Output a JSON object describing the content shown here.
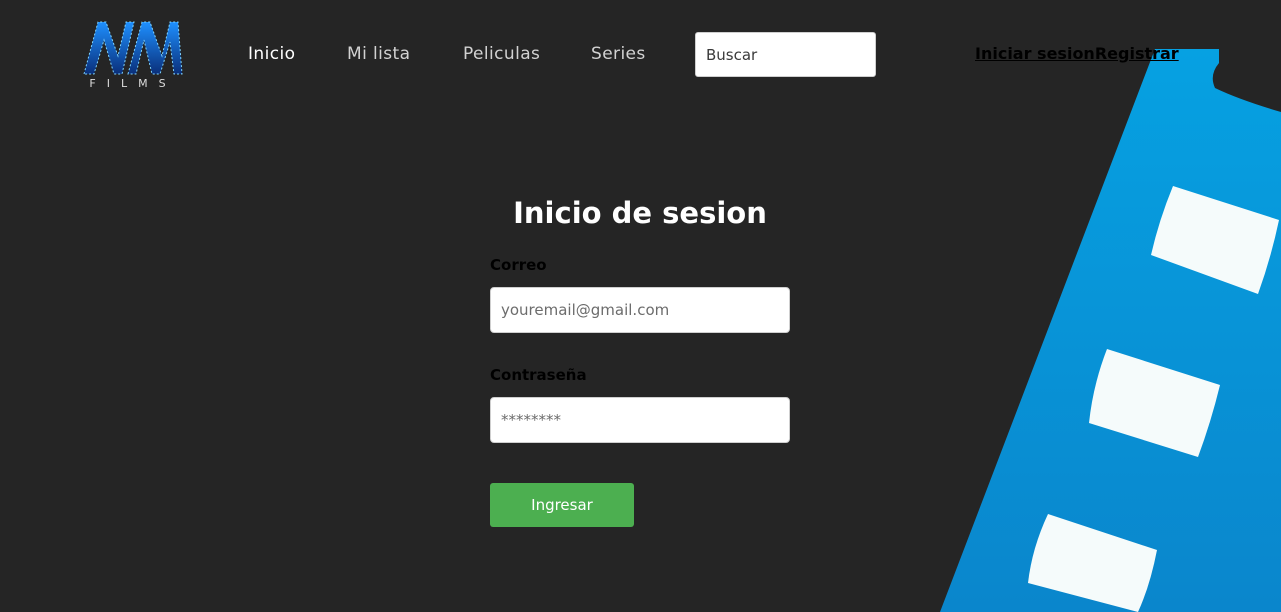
{
  "brand": {
    "logo_text": "FILMS",
    "logo_colors": [
      "#0a3a8a",
      "#1e90ff",
      "#ffffff"
    ]
  },
  "nav": {
    "items": [
      {
        "label": "Inicio",
        "active": true
      },
      {
        "label": "Mi lista",
        "active": false
      },
      {
        "label": "Peliculas",
        "active": false
      },
      {
        "label": "Series",
        "active": false
      }
    ]
  },
  "search": {
    "placeholder": "Buscar",
    "value": ""
  },
  "auth": {
    "login_label": "Iniciar sesion",
    "register_label": "Registrar"
  },
  "login_form": {
    "title": "Inicio de sesion",
    "email_label": "Correo",
    "email_placeholder": "youremail@gmail.com",
    "password_label": "Contraseña",
    "password_placeholder": "********",
    "submit_label": "Ingresar"
  },
  "colors": {
    "background": "#252525",
    "accent_blue": "#0a98dc",
    "button_green": "#4caf50",
    "film_hole": "#f5fbfb"
  },
  "icons": {
    "logo": "mm-films-logo",
    "decoration": "film-strip-decoration"
  }
}
